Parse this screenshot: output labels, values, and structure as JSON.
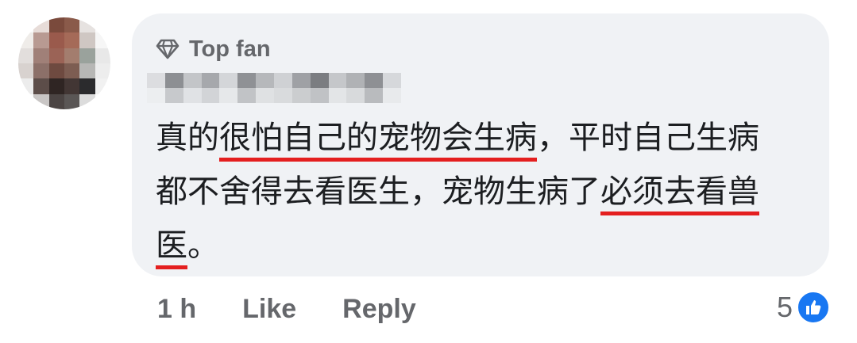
{
  "comment": {
    "badge_label": "Top fan",
    "badge_icon": "diamond-icon",
    "lines": [
      [
        {
          "text": "真的",
          "underline": false
        },
        {
          "text": "很怕自己的宠物会生病",
          "underline": true
        },
        {
          "text": "，平时自己生病",
          "underline": false
        }
      ],
      [
        {
          "text": "都不舍得去看医生，宠物生病了",
          "underline": false
        },
        {
          "text": "必须去看兽",
          "underline": true
        }
      ],
      [
        {
          "text": "医",
          "underline": true
        },
        {
          "text": "。",
          "underline": false
        }
      ]
    ]
  },
  "actions": {
    "time": "1 h",
    "like_label": "Like",
    "reply_label": "Reply"
  },
  "reactions": {
    "count": "5",
    "icon": "thumbs-up-icon"
  },
  "colors": {
    "bubble_bg": "#f0f2f5",
    "text": "#1c1e21",
    "muted": "#65676b",
    "underline": "#e41f1f",
    "like_blue": "#1877f2"
  }
}
